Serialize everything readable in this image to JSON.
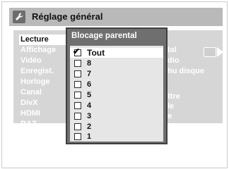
{
  "header": {
    "title": "Réglage général"
  },
  "left_menu": {
    "items": [
      "Lecture",
      "Affichage",
      "Vidéo",
      "Enregist.",
      "Horloge",
      "Canal",
      "DivX",
      "HDMI",
      "RAZ"
    ]
  },
  "right_menu": {
    "items": [
      "tal",
      "dio",
      "hu disque",
      "ttre",
      "le",
      "e"
    ]
  },
  "popup": {
    "title": "Blocage parental",
    "options": [
      {
        "label": "Tout",
        "checked": true
      },
      {
        "label": "8",
        "checked": false
      },
      {
        "label": "7",
        "checked": false
      },
      {
        "label": "6",
        "checked": false
      },
      {
        "label": "5",
        "checked": false
      },
      {
        "label": "4",
        "checked": false
      },
      {
        "label": "3",
        "checked": false
      },
      {
        "label": "2",
        "checked": false
      },
      {
        "label": "1",
        "checked": false
      }
    ]
  },
  "icons": {
    "title": "wrench-icon",
    "right": "tv-icon",
    "arrow": "arrow-right-icon",
    "check": "checkmark-icon"
  }
}
